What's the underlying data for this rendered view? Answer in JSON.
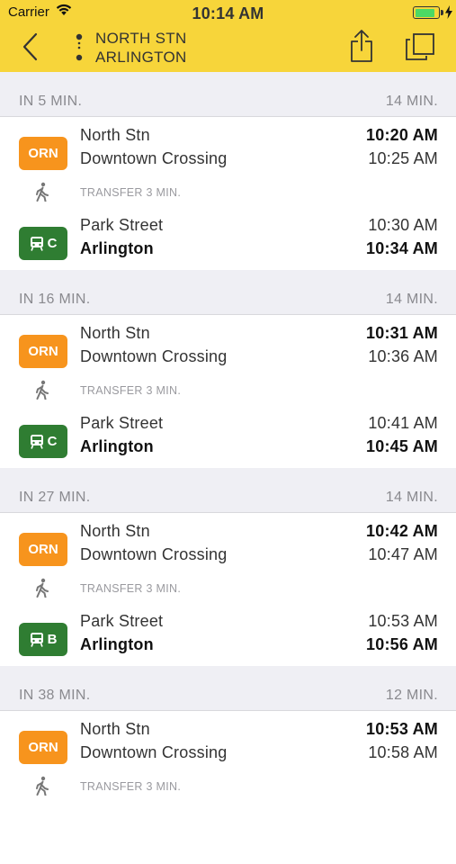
{
  "status_bar": {
    "carrier": "Carrier",
    "time": "10:14 AM",
    "battery_level": 0.85,
    "battery_color": "#4cd964"
  },
  "nav": {
    "origin": "NORTH STN",
    "destination": "ARLINGTON",
    "bar_color": "#f7d53a"
  },
  "trips": [
    {
      "departs_in": "IN 5 MIN.",
      "duration": "14 MIN.",
      "leg1": {
        "route": "ORN",
        "from": "North Stn",
        "to": "Downtown Crossing",
        "depart": "10:20 AM",
        "arrive": "10:25 AM"
      },
      "transfer": "TRANSFER 3 MIN.",
      "leg2": {
        "route": "C",
        "from": "Park Street",
        "to": "Arlington",
        "depart": "10:30 AM",
        "arrive": "10:34 AM"
      }
    },
    {
      "departs_in": "IN 16 MIN.",
      "duration": "14 MIN.",
      "leg1": {
        "route": "ORN",
        "from": "North Stn",
        "to": "Downtown Crossing",
        "depart": "10:31 AM",
        "arrive": "10:36 AM"
      },
      "transfer": "TRANSFER 3 MIN.",
      "leg2": {
        "route": "C",
        "from": "Park Street",
        "to": "Arlington",
        "depart": "10:41 AM",
        "arrive": "10:45 AM"
      }
    },
    {
      "departs_in": "IN 27 MIN.",
      "duration": "14 MIN.",
      "leg1": {
        "route": "ORN",
        "from": "North Stn",
        "to": "Downtown Crossing",
        "depart": "10:42 AM",
        "arrive": "10:47 AM"
      },
      "transfer": "TRANSFER 3 MIN.",
      "leg2": {
        "route": "B",
        "from": "Park Street",
        "to": "Arlington",
        "depart": "10:53 AM",
        "arrive": "10:56 AM"
      }
    },
    {
      "departs_in": "IN 38 MIN.",
      "duration": "12 MIN.",
      "leg1": {
        "route": "ORN",
        "from": "North Stn",
        "to": "Downtown Crossing",
        "depart": "10:53 AM",
        "arrive": "10:58 AM"
      },
      "transfer": "TRANSFER 3 MIN."
    }
  ],
  "colors": {
    "orange_line": "#f7941d",
    "green_line": "#2f7d32"
  },
  "icons": [
    "wifi-icon",
    "battery-icon",
    "charging-bolt-icon",
    "back-chevron-icon",
    "route-dots-icon",
    "share-icon",
    "copy-icon",
    "walking-icon",
    "train-icon"
  ]
}
